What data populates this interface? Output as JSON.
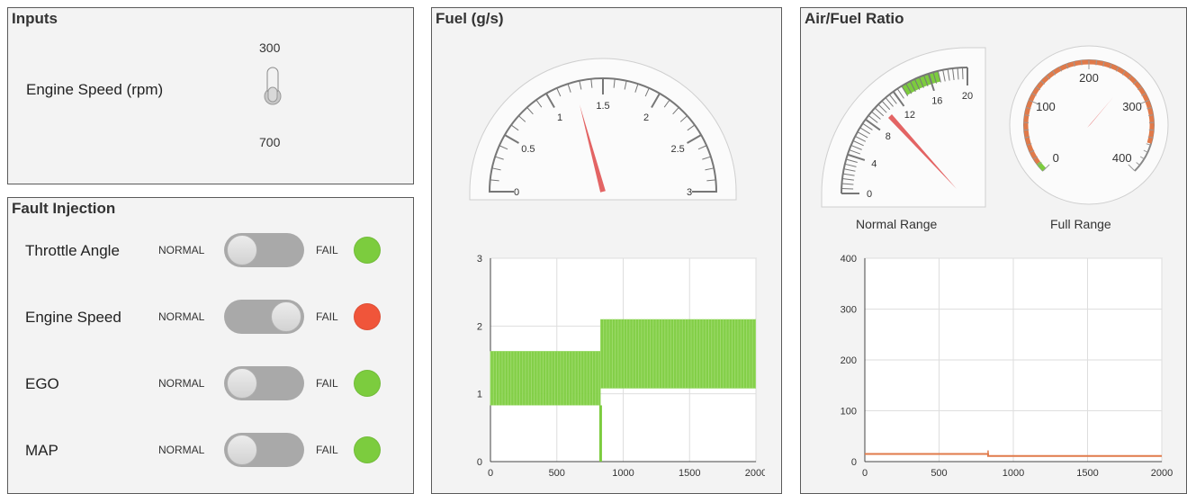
{
  "inputs": {
    "title": "Inputs",
    "engine_speed_label": "Engine Speed (rpm)",
    "switch_top_label": "300",
    "switch_bottom_label": "700"
  },
  "fault": {
    "title": "Fault Injection",
    "normal_label": "NORMAL",
    "fail_label": "FAIL",
    "rows": [
      {
        "label": "Throttle Angle",
        "state": "NORMAL",
        "lamp_color": "#7ccc3e"
      },
      {
        "label": "Engine Speed",
        "state": "FAIL",
        "lamp_color": "#f0553a"
      },
      {
        "label": "EGO",
        "state": "NORMAL",
        "lamp_color": "#7ccc3e"
      },
      {
        "label": "MAP",
        "state": "NORMAL",
        "lamp_color": "#7ccc3e"
      }
    ]
  },
  "fuel": {
    "title": "Fuel (g/s)",
    "gauge": {
      "min": 0,
      "max": 3,
      "tick_labels": [
        "0",
        "0.5",
        "1",
        "1.5",
        "2",
        "2.5",
        "3"
      ],
      "needle_value": 1.25
    },
    "chart_data": {
      "type": "line",
      "xlim": [
        0,
        2000
      ],
      "ylim": [
        0,
        3
      ],
      "x_ticks": [
        "0",
        "500",
        "1000",
        "1500",
        "2000"
      ],
      "y_ticks": [
        "0",
        "1",
        "2",
        "3"
      ],
      "grid": true,
      "series": [
        {
          "band_segments": [
            {
              "x": [
                0,
                830
              ],
              "low": 0.83,
              "high": 1.63
            },
            {
              "x": [
                830,
                2000
              ],
              "low": 1.08,
              "high": 2.1
            }
          ],
          "dip": {
            "x": 830,
            "y": 0
          },
          "color": "#7ccc3e"
        }
      ]
    }
  },
  "afr": {
    "title": "Air/Fuel Ratio",
    "normal_gauge": {
      "caption": "Normal Range",
      "min": 0,
      "max": 20,
      "tick_labels": [
        "0",
        "4",
        "8",
        "12",
        "16",
        "20"
      ],
      "green_band": [
        13,
        17
      ],
      "needle_value": 11
    },
    "full_gauge": {
      "caption": "Full Range",
      "min": 0,
      "max": 400,
      "tick_labels": [
        "0",
        "100",
        "200",
        "300",
        "400"
      ],
      "needle_value": 50,
      "band_color": "#e07a4a"
    },
    "chart_data": {
      "type": "line",
      "xlim": [
        0,
        2000
      ],
      "ylim": [
        0,
        400
      ],
      "x_ticks": [
        "0",
        "500",
        "1000",
        "1500",
        "2000"
      ],
      "y_ticks": [
        "0",
        "100",
        "200",
        "300",
        "400"
      ],
      "grid": true,
      "series": [
        {
          "x": [
            0,
            830,
            830,
            2000
          ],
          "y": [
            15,
            15,
            11,
            11
          ],
          "color": "#e07a4a"
        }
      ]
    }
  },
  "colors": {
    "green": "#7ccc3e",
    "red": "#f0553a",
    "orange": "#e07a4a",
    "needle": "#e36464"
  }
}
